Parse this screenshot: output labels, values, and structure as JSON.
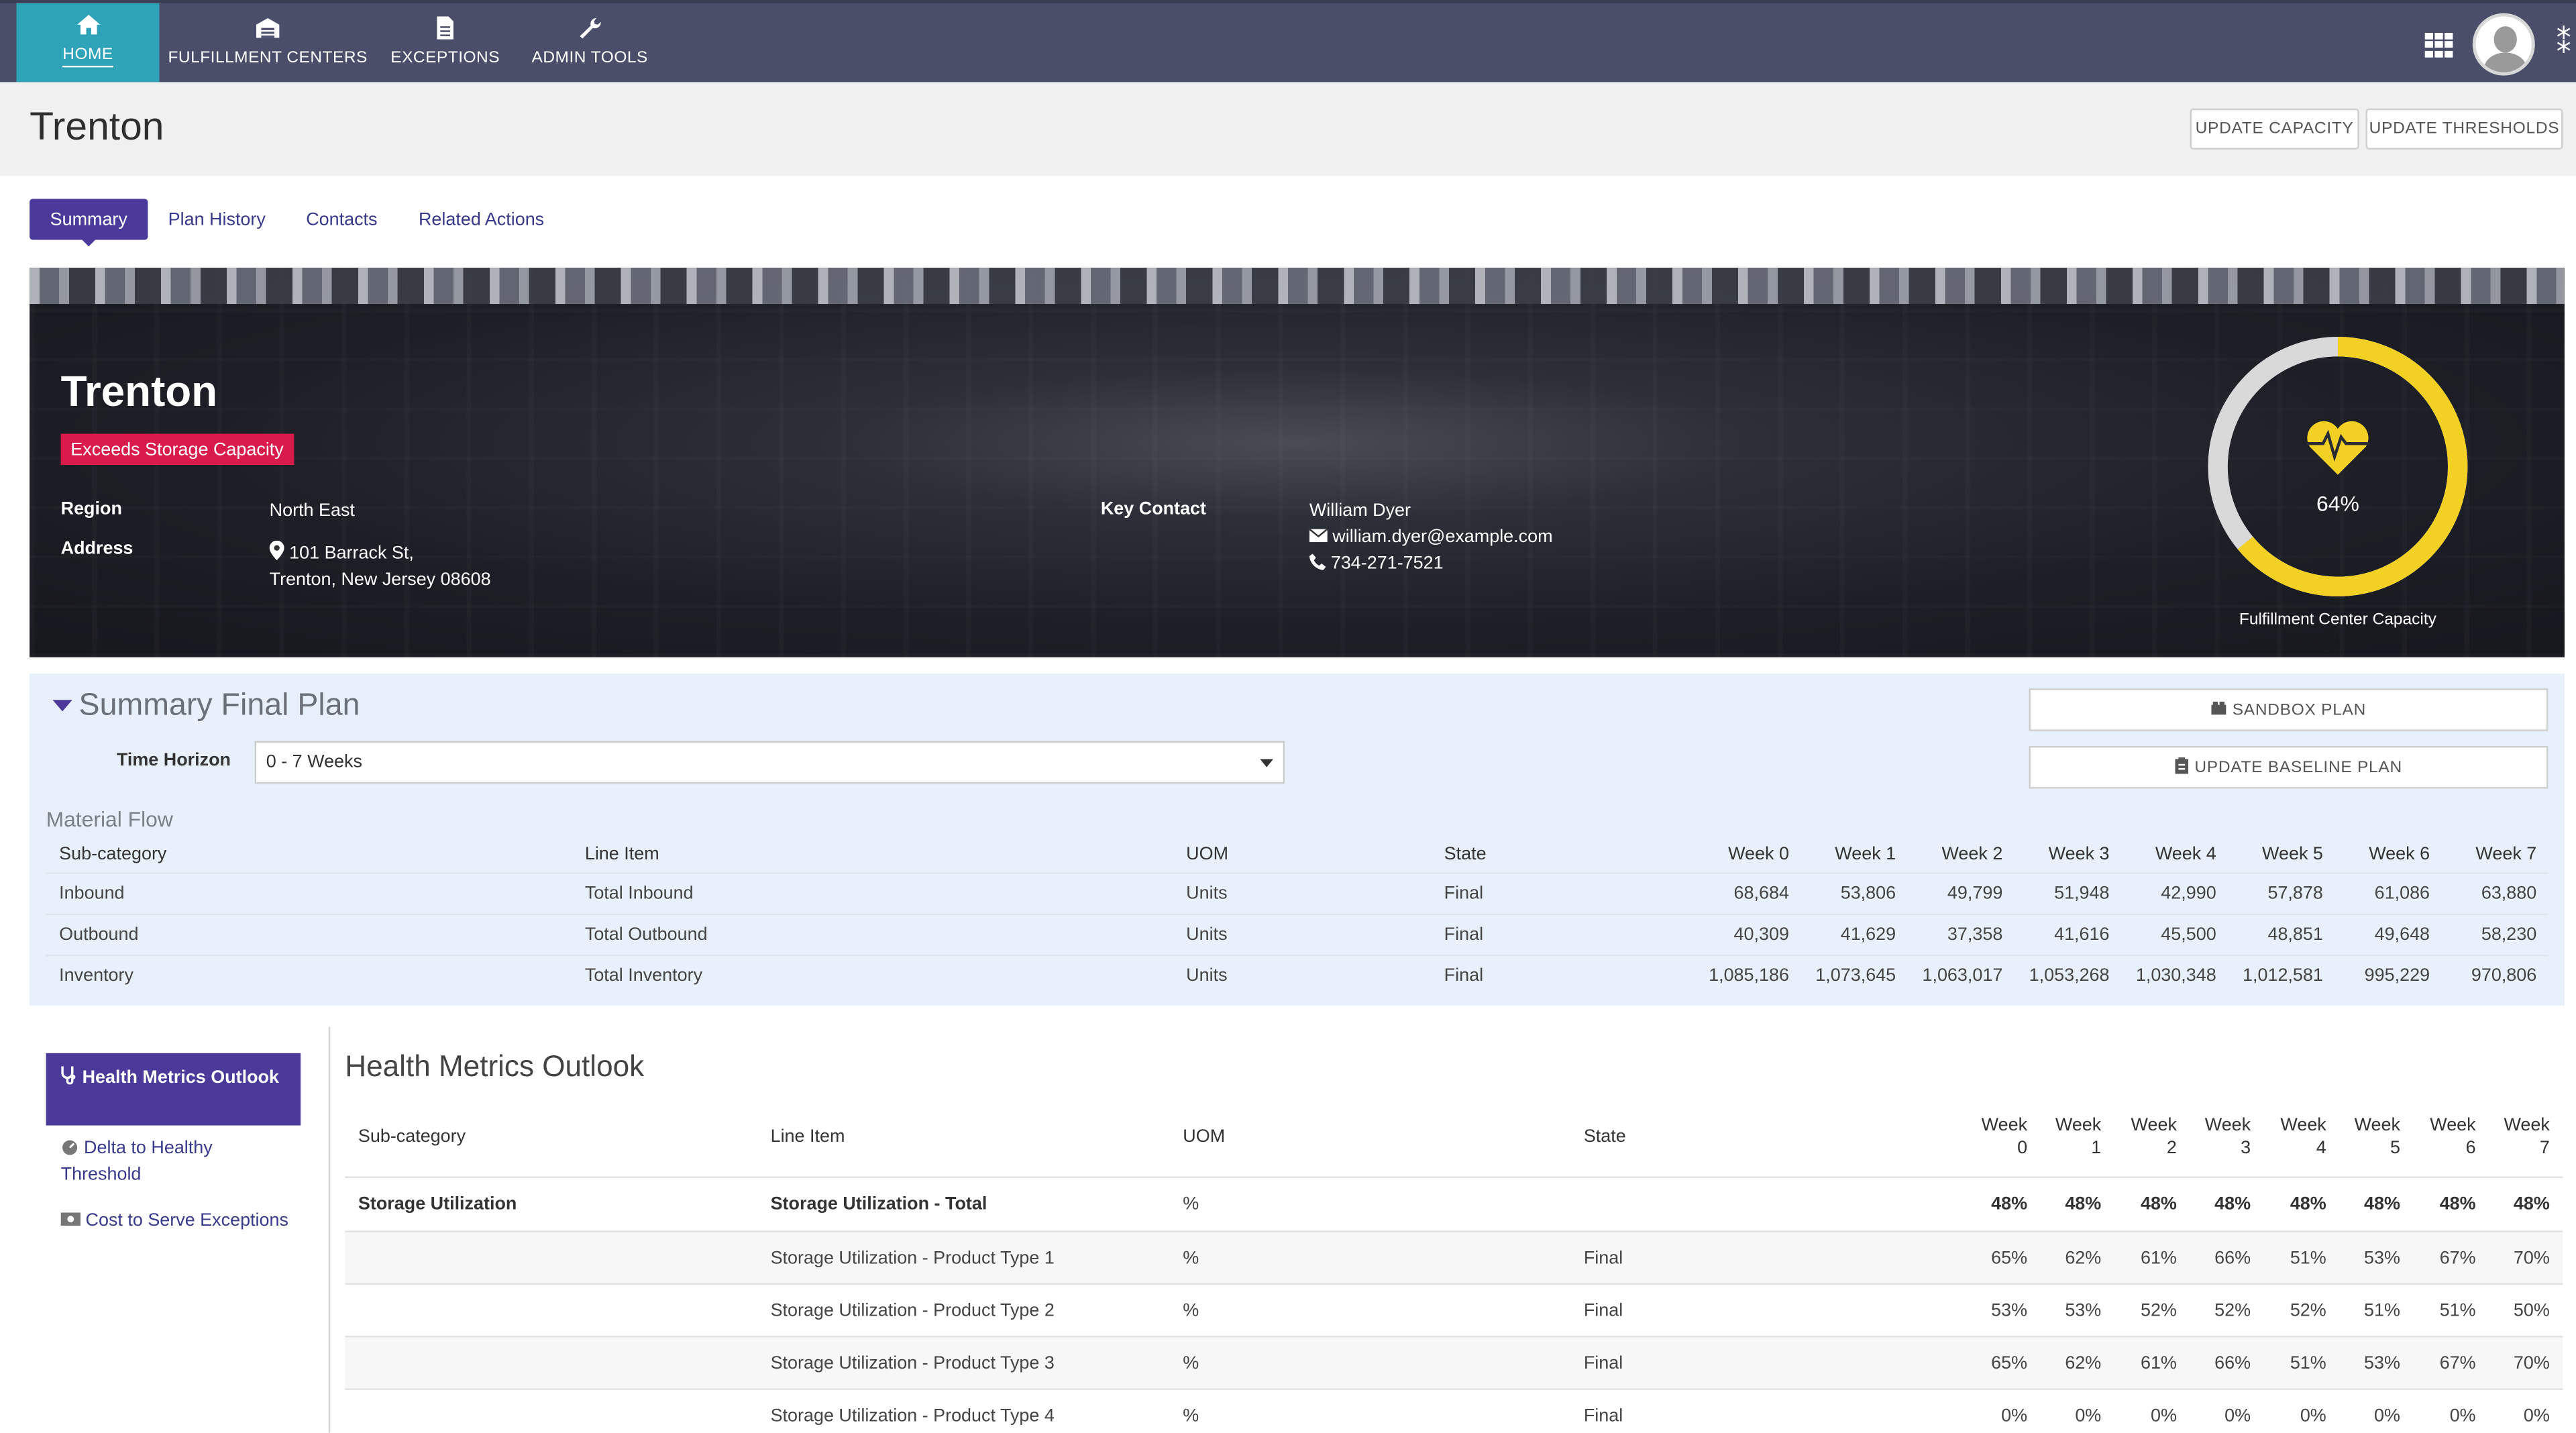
{
  "nav": {
    "items": [
      {
        "label": "HOME",
        "icon": "home-icon"
      },
      {
        "label": "FULFILLMENT CENTERS",
        "icon": "warehouse-icon"
      },
      {
        "label": "EXCEPTIONS",
        "icon": "document-icon"
      },
      {
        "label": "ADMIN TOOLS",
        "icon": "wrench-icon"
      }
    ],
    "active_color": "#2fa3b8",
    "bar_color": "#4a4e69"
  },
  "page": {
    "title": "Trenton",
    "buttons": {
      "update_capacity": "UPDATE CAPACITY",
      "update_thresholds": "UPDATE THRESHOLDS"
    }
  },
  "tabs": [
    "Summary",
    "Plan History",
    "Contacts",
    "Related Actions"
  ],
  "hero": {
    "name": "Trenton",
    "status_badge": "Exceeds Storage Capacity",
    "region_label": "Region",
    "region_value": "North East",
    "address_label": "Address",
    "address_line1": "101 Barrack St,",
    "address_line2": "Trenton, New Jersey 08608",
    "key_contact_label": "Key Contact",
    "contact_name": "William Dyer",
    "contact_email": "william.dyer@example.com",
    "contact_phone": "734-271-7521",
    "capacity_value": 0.64,
    "capacity_pct": "64%",
    "capacity_caption": "Fulfillment Center Capacity",
    "gauge_color": "#f2d024",
    "badge_color": "#d81b4a"
  },
  "plan": {
    "title": "Summary Final Plan",
    "time_horizon_label": "Time Horizon",
    "time_horizon_value": "0 - 7 Weeks",
    "sandbox_button": "SANDBOX PLAN",
    "baseline_button": "UPDATE BASELINE PLAN",
    "material_flow_label": "Material Flow",
    "headers": {
      "subcategory": "Sub-category",
      "line_item": "Line Item",
      "uom": "UOM",
      "state": "State"
    },
    "weeks": [
      "Week 0",
      "Week 1",
      "Week 2",
      "Week 3",
      "Week 4",
      "Week 5",
      "Week 6",
      "Week 7"
    ],
    "rows": [
      {
        "subcategory": "Inbound",
        "line_item": "Total Inbound",
        "uom": "Units",
        "state": "Final",
        "values": [
          "68,684",
          "53,806",
          "49,799",
          "51,948",
          "42,990",
          "57,878",
          "61,086",
          "63,880"
        ]
      },
      {
        "subcategory": "Outbound",
        "line_item": "Total Outbound",
        "uom": "Units",
        "state": "Final",
        "values": [
          "40,309",
          "41,629",
          "37,358",
          "41,616",
          "45,500",
          "48,851",
          "49,648",
          "58,230"
        ]
      },
      {
        "subcategory": "Inventory",
        "line_item": "Total Inventory",
        "uom": "Units",
        "state": "Final",
        "values": [
          "1,085,186",
          "1,073,645",
          "1,063,017",
          "1,053,268",
          "1,030,348",
          "1,012,581",
          "995,229",
          "970,806"
        ]
      }
    ]
  },
  "sidebar": {
    "active": "Health Metrics Outlook",
    "links": [
      "Delta to Healthy Threshold",
      "Cost to Serve Exceptions"
    ]
  },
  "health": {
    "title": "Health Metrics Outlook",
    "headers": {
      "subcategory": "Sub-category",
      "line_item": "Line Item",
      "uom": "UOM",
      "state": "State"
    },
    "weeks": [
      {
        "top": "Week",
        "bottom": "0"
      },
      {
        "top": "Week",
        "bottom": "1"
      },
      {
        "top": "Week",
        "bottom": "2"
      },
      {
        "top": "Week",
        "bottom": "3"
      },
      {
        "top": "Week",
        "bottom": "4"
      },
      {
        "top": "Week",
        "bottom": "5"
      },
      {
        "top": "Week",
        "bottom": "6"
      },
      {
        "top": "Week",
        "bottom": "7"
      }
    ],
    "rows": [
      {
        "subcategory": "Storage Utilization",
        "line_item": "Storage Utilization - Total",
        "uom": "%",
        "state": "",
        "values": [
          "48%",
          "48%",
          "48%",
          "48%",
          "48%",
          "48%",
          "48%",
          "48%"
        ],
        "bold": true
      },
      {
        "subcategory": "",
        "line_item": "Storage Utilization - Product Type 1",
        "uom": "%",
        "state": "Final",
        "values": [
          "65%",
          "62%",
          "61%",
          "66%",
          "51%",
          "53%",
          "67%",
          "70%"
        ]
      },
      {
        "subcategory": "",
        "line_item": "Storage Utilization - Product Type 2",
        "uom": "%",
        "state": "Final",
        "values": [
          "53%",
          "53%",
          "52%",
          "52%",
          "52%",
          "51%",
          "51%",
          "50%"
        ]
      },
      {
        "subcategory": "",
        "line_item": "Storage Utilization - Product Type 3",
        "uom": "%",
        "state": "Final",
        "values": [
          "65%",
          "62%",
          "61%",
          "66%",
          "51%",
          "53%",
          "67%",
          "70%"
        ]
      },
      {
        "subcategory": "",
        "line_item": "Storage Utilization - Product Type 4",
        "uom": "%",
        "state": "Final",
        "values": [
          "0%",
          "0%",
          "0%",
          "0%",
          "0%",
          "0%",
          "0%",
          "0%"
        ]
      }
    ]
  }
}
